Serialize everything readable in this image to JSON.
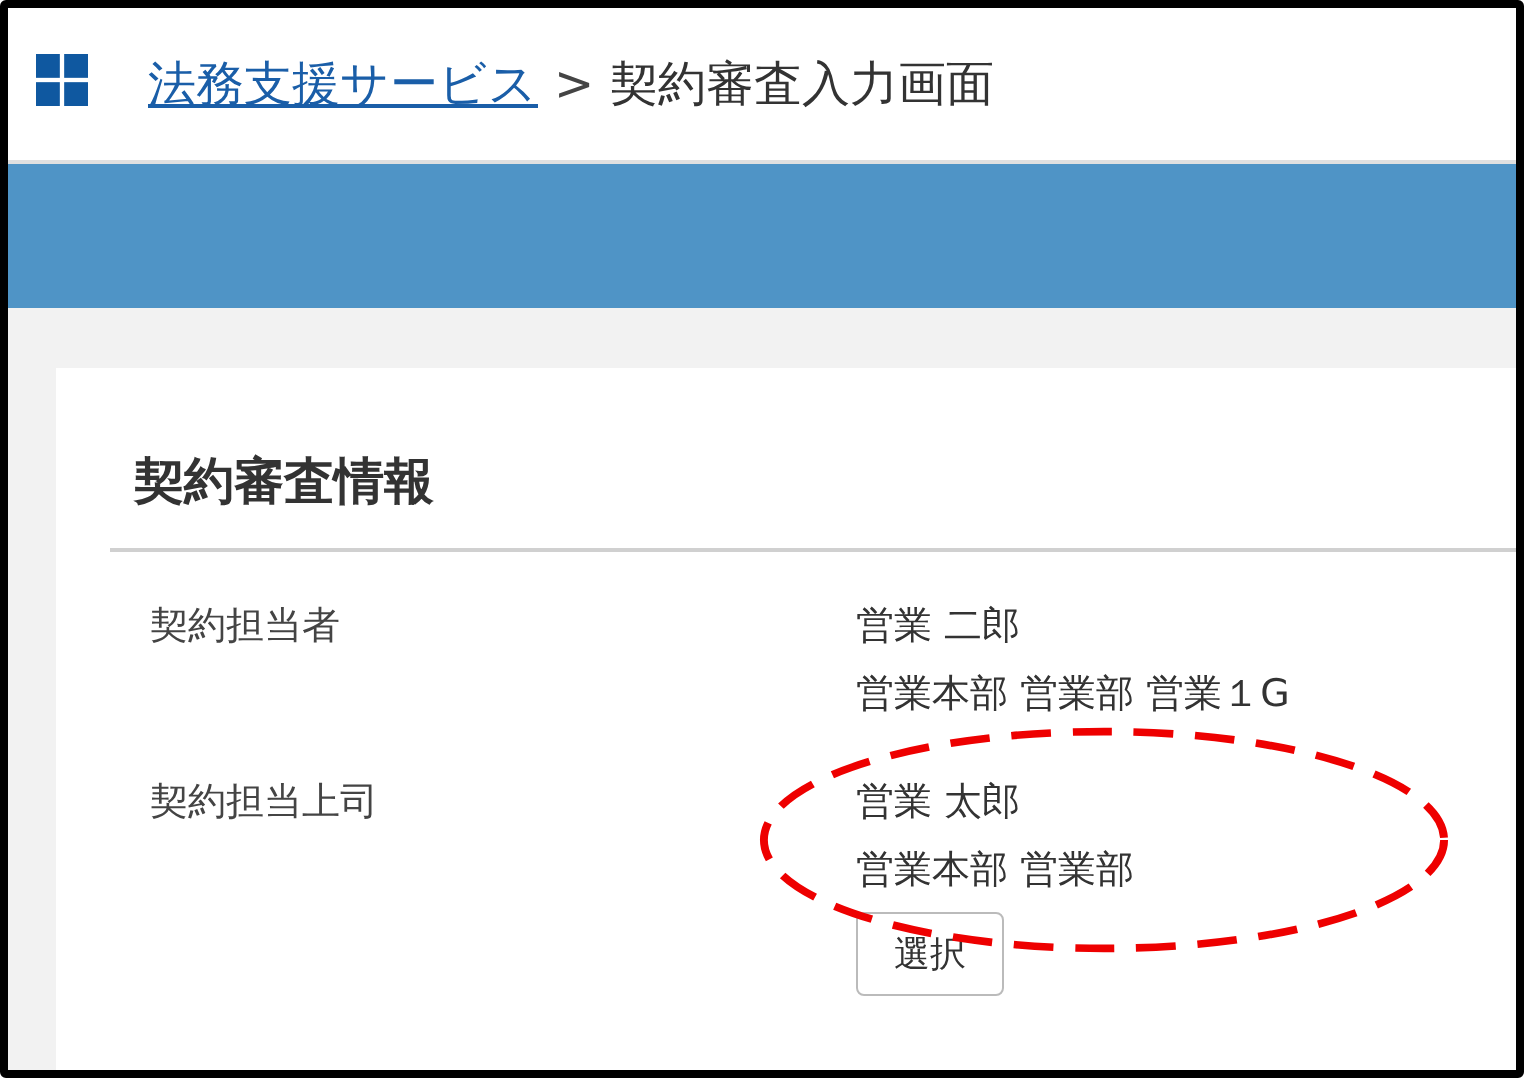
{
  "header": {
    "link": "法務支援サービス",
    "separator": ">",
    "current": "契約審査入力画面"
  },
  "section": {
    "title": "契約審査情報",
    "fields": [
      {
        "label": "契約担当者",
        "values": [
          "営業 二郎",
          "営業本部 営業部 営業１G"
        ],
        "highlighted": false
      },
      {
        "label": "契約担当上司",
        "values": [
          "営業 太郎",
          "営業本部 営業部"
        ],
        "highlighted": true,
        "button": "選択"
      }
    ]
  }
}
